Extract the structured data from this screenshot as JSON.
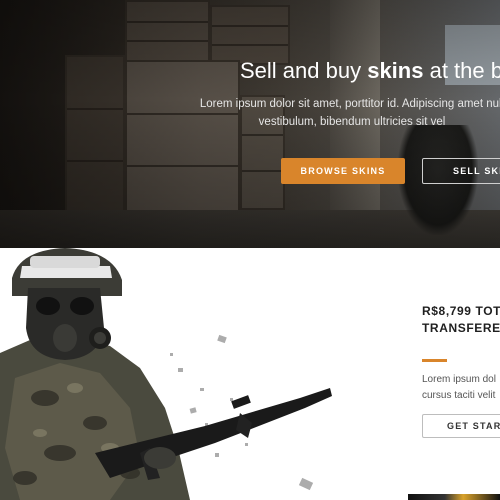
{
  "hero": {
    "title_prefix": "Sell and buy ",
    "title_bold": "skins",
    "title_suffix": " at the be",
    "subtitle": "Lorem ipsum dolor sit amet, porttitor id. Adipiscing amet null vestibulum, bibendum ultricies sit vel",
    "browse_button": "BROWSE SKINS",
    "sell_button": "SELL SKI"
  },
  "promo": {
    "stat_line1": "R$8,799 TOT",
    "stat_line2": "TRANSFERED",
    "text_line1": "Lorem ipsum dol",
    "text_line2": "cursus taciti velit",
    "start_button": "GET STAR"
  },
  "colors": {
    "accent": "#d9852b",
    "dark_text": "#1f1f1f"
  }
}
